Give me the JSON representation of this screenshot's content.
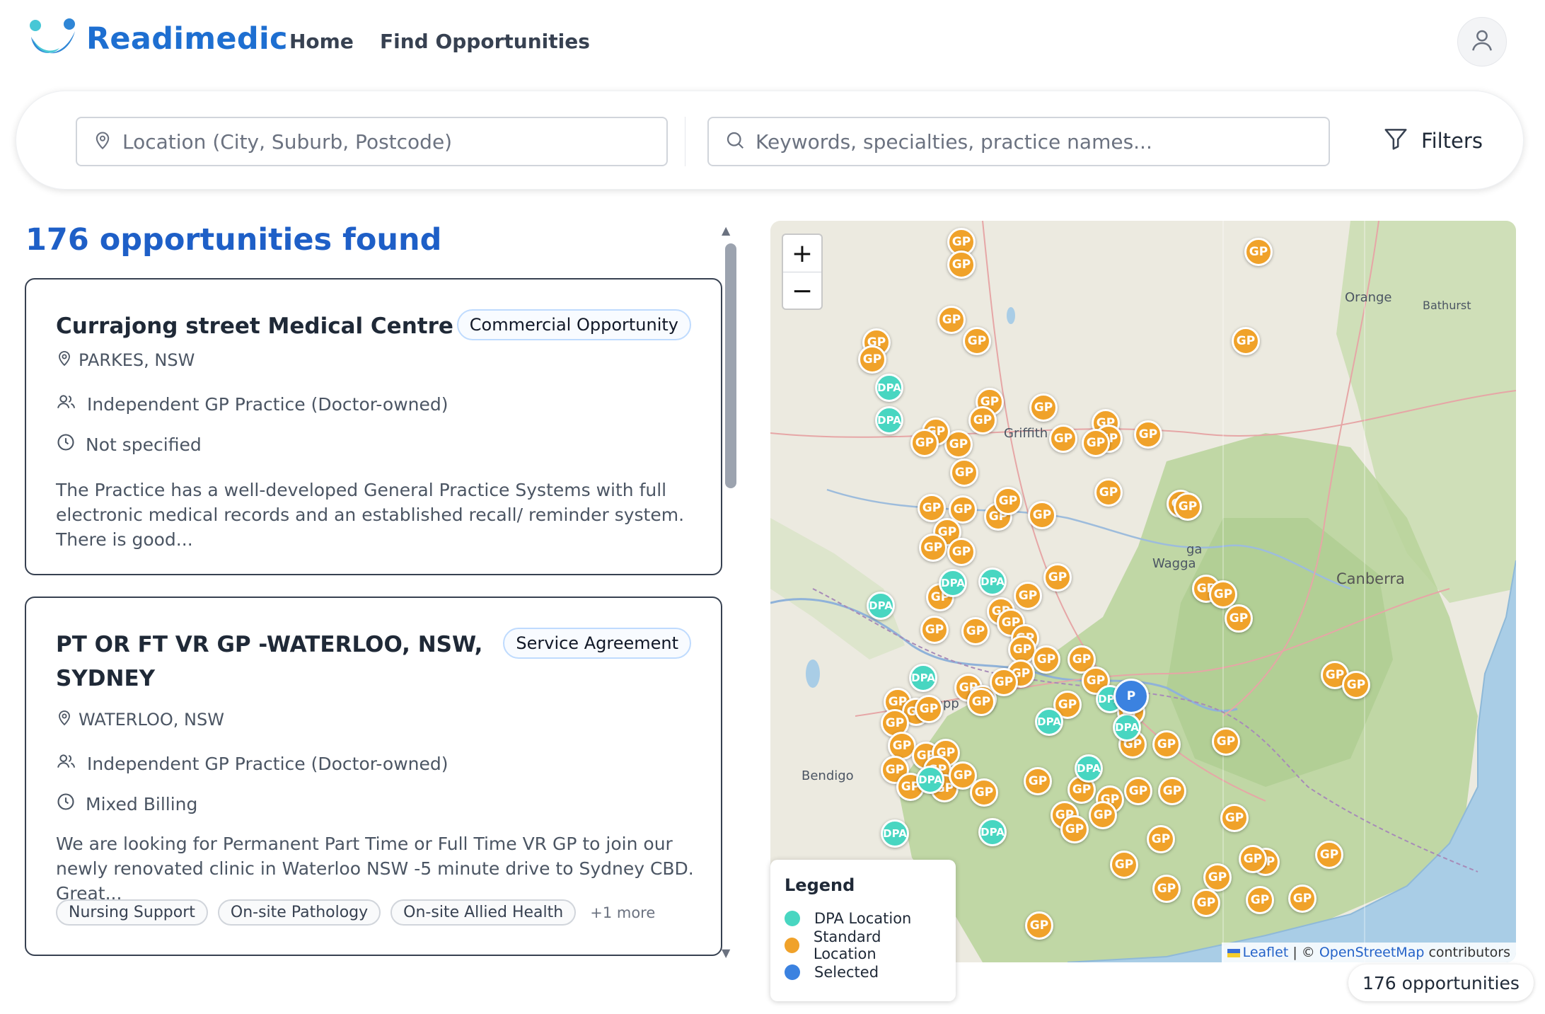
{
  "header": {
    "brand": "Readimedic",
    "nav": {
      "home": "Home",
      "find": "Find Opportunities"
    },
    "icons": {
      "logo": "readimedic-logo",
      "account": "user-icon"
    }
  },
  "search": {
    "location_placeholder": "Location (City, Suburb, Postcode)",
    "keywords_placeholder": "Keywords, specialties, practice names...",
    "filters_label": "Filters"
  },
  "results": {
    "title": "176 opportunities found",
    "cards": [
      {
        "title": "Currajong street Medical Centre",
        "badge": "Commercial Opportunity",
        "location": "PARKES, NSW",
        "practice_type": "Independent GP Practice (Doctor-owned)",
        "billing": "Not specified",
        "description": "The Practice has a well-developed General Practice Systems with full electronic medical records and an established recall/ reminder system. There is good...",
        "tags": []
      },
      {
        "title_line1": "PT OR FT VR GP -WATERLOO, NSW,",
        "title_line2": "SYDNEY",
        "badge": "Service Agreement",
        "location": "WATERLOO, NSW",
        "practice_type": "Independent GP Practice (Doctor-owned)",
        "billing": "Mixed Billing",
        "description": "We are looking for Permanent Part Time or Full Time VR GP to join our newly renovated clinic in Waterloo NSW -5 minute drive to Sydney CBD. Great...",
        "tags": [
          "Nursing Support",
          "On-site Pathology",
          "On-site Allied Health"
        ],
        "more": "+1 more"
      }
    ]
  },
  "map": {
    "zoom_in": "+",
    "zoom_out": "−",
    "places": {
      "orange": "Orange",
      "bathurst": "Bathurst",
      "griffith": "Griffith",
      "wagga_1": "ga",
      "wagga_2": "Wagga",
      "canberra": "Canberra",
      "shepparton": "Shepp",
      "bendigo": "Bendigo"
    },
    "marker_labels": {
      "gp": "GP",
      "dpa": "DPA",
      "selected": "P"
    },
    "attribution": {
      "leaflet": "Leaflet",
      "sep": " | © ",
      "osm": "OpenStreetMap",
      "suffix": " contributors"
    },
    "colors": {
      "dpa": "#48d6c1",
      "standard": "#f0a22a",
      "selected": "#3b82e0"
    }
  },
  "legend": {
    "title": "Legend",
    "dpa": "DPA Location",
    "standard": "Standard Location",
    "selected": "Selected"
  },
  "footer": {
    "count": "176 opportunities"
  }
}
